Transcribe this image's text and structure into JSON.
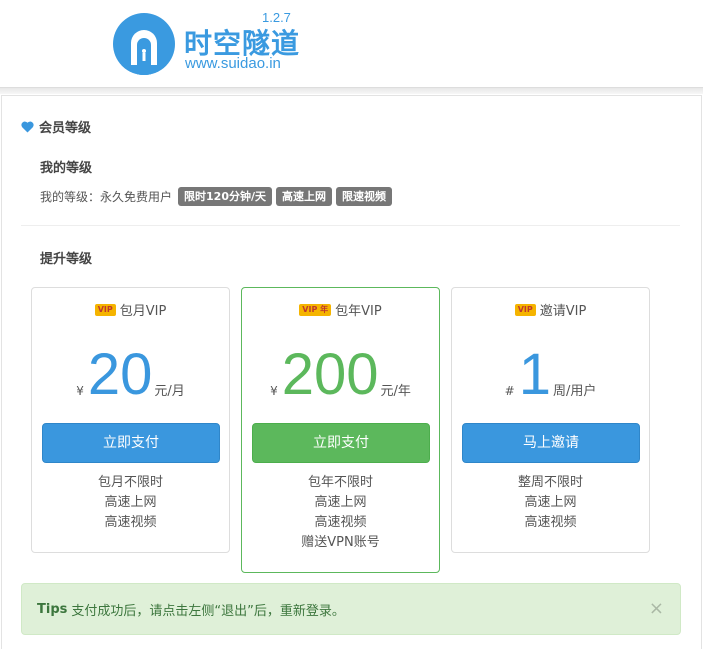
{
  "header": {
    "logo_title": "时空隧道",
    "logo_url": "www.suidao.in",
    "version": "1.2.7"
  },
  "membership": {
    "section_title": "会员等级",
    "my_level_title": "我的等级",
    "my_level_label": "我的等级：永久免费用户",
    "badges": [
      "限时120分钟/天",
      "高速上网",
      "限速视频"
    ],
    "upgrade_title": "提升等级"
  },
  "plans": [
    {
      "tag": "VIP",
      "name": "包月VIP",
      "symbol": "¥",
      "price": "20",
      "unit": "元/月",
      "button": "立即支付",
      "features": [
        "包月不限时",
        "高速上网",
        "高速视频"
      ],
      "color": "#3a97de"
    },
    {
      "tag": "VIP 年",
      "name": "包年VIP",
      "symbol": "¥",
      "price": "200",
      "unit": "元/年",
      "button": "立即支付",
      "features": [
        "包年不限时",
        "高速上网",
        "高速视频",
        "赠送VPN账号"
      ],
      "color": "#5cb85c"
    },
    {
      "tag": "VIP",
      "name": "邀请VIP",
      "symbol": "#",
      "price": "1",
      "unit": "周/用户",
      "button": "马上邀请",
      "features": [
        "整周不限时",
        "高速上网",
        "高速视频"
      ],
      "color": "#3a97de"
    }
  ],
  "tips": {
    "label": "Tips",
    "text": "支付成功后，请点击左侧“退出”后，重新登录。",
    "close": "×"
  },
  "icons": {
    "heart": "heart-icon",
    "logo": "tunnel-logo-icon",
    "close": "close-icon"
  }
}
